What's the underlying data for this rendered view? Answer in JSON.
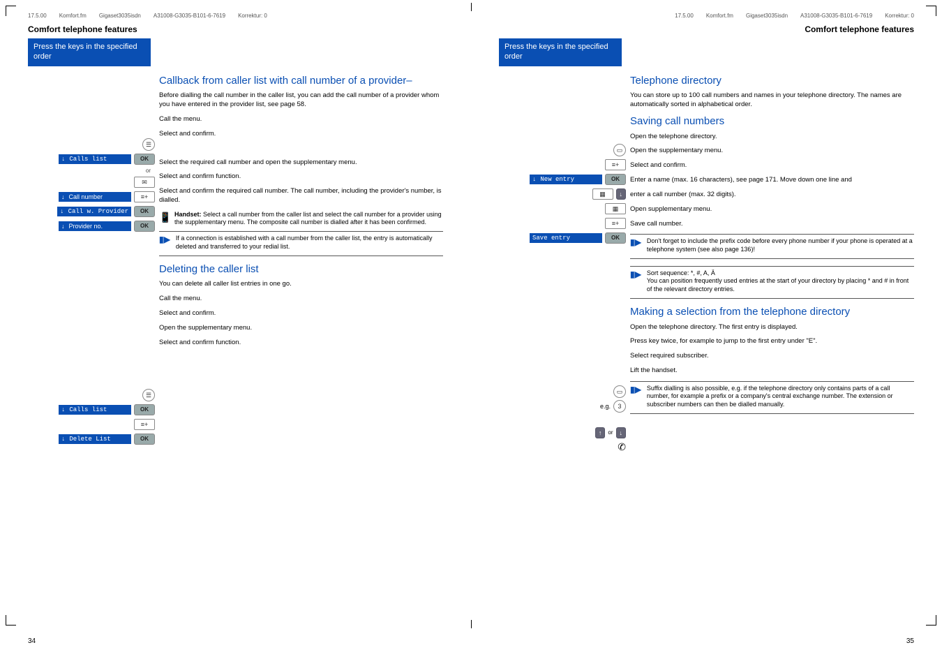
{
  "crop_marks": true,
  "left": {
    "header_items": [
      "17.5.00",
      "Komfort.fm",
      "Gigaset3035isdn",
      "A31008-G3035-B101-6-7619",
      "Korrektur: 0"
    ],
    "section": "Comfort telephone features",
    "ribbon": "Press the keys in the specified order",
    "h1": "Callback from caller list with call number of a provider– ",
    "p1": "Before dialling the call number in the caller list, you can add the call number of a provider whom you have entered in the provider list, see page 58.",
    "s_menu": "Call the menu.",
    "nav_calls": "Calls list",
    "s_select": "Select and confirm.",
    "or": "or",
    "nav_callnum": "Call number",
    "s_callnum": "Select the required call number and open the supplementary menu.",
    "nav_callwprov": "Call w. Provider",
    "s_func": "Select and confirm function.",
    "nav_prov": "Provider no.",
    "s_prov": "Select and confirm the required call number. The call number, including the provider's number, is dialled.",
    "handset_label": "Handset:",
    "handset_text": " Select a call number from the caller list and select the call number for a provider using the supplementary menu. The composite call number is dialled after it has been confirmed.",
    "note1": "If a connection is established with a call number from the caller list, the entry is automatically deleted and transferred to your redial list.",
    "h2": "Deleting the caller list ",
    "p2": "You can delete all caller list entries in one go.",
    "s_menu2": "Call the menu.",
    "s_select2": "Select and confirm.",
    "s_supp": "Open the supplementary menu.",
    "nav_delete": "Delete List",
    "s_delfunc": "Select and confirm function.",
    "page_number": "34"
  },
  "right": {
    "header_items": [
      "17.5.00",
      "Komfort.fm",
      "Gigaset3035isdn",
      "A31008-G3035-B101-6-7619",
      "Korrektur: 0"
    ],
    "section": "Comfort telephone features",
    "ribbon": "Press the keys in the specified order",
    "h1": "Telephone directory",
    "p1": "You can store up to 100 call numbers and names in your telephone directory. The names are automatically sorted in alphabetical order.",
    "h2": "Saving call numbers",
    "s_open": "Open the telephone directory.",
    "s_supp": "Open the supplementary menu.",
    "nav_new": "New entry",
    "s_confirm": "Select and confirm.",
    "s_name": "Enter a name (max. 16 characters), see page 171. Move down one line and",
    "s_num": "enter a call number (max. 32 digits).",
    "s_supp2": "Open supplementary menu.",
    "nav_save": "Save entry",
    "s_save": "Save call number.",
    "note_prefix": "Don't forget to include the prefix code before every phone number if your phone is operated at a telephone system (see also page 136)!",
    "note_sort": "Sort sequence: *, #, A, Ä\nYou can position frequently used entries at the start of your directory by placing * and # in front of the relevant directory entries.",
    "h3": "Making a selection from the telephone directory",
    "s_open2": "Open the telephone directory. The first entry is displayed.",
    "eg": "e.g.",
    "key3": "3",
    "s_eg": "Press key twice, for example to jump to the first entry under \"E\".",
    "s_selreq": "Select required subscriber.",
    "s_lift": "Lift the handset.",
    "note_suffix": "Suffix dialling is also possible, e.g. if the telephone directory only contains parts of a call number, for example a prefix or a company's central exchange number. The extension or subscriber numbers can then be dialled manually.",
    "page_number": "35"
  }
}
